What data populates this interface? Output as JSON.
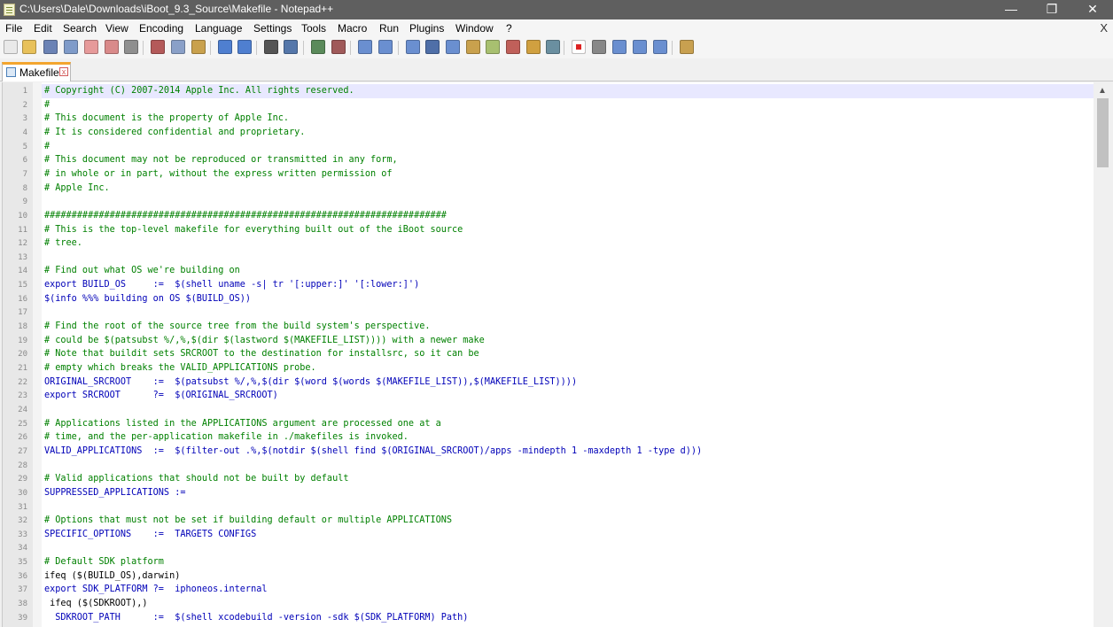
{
  "window": {
    "title": "C:\\Users\\Dale\\Downloads\\iBoot_9.3_Source\\Makefile - Notepad++",
    "minimize_glyph": "—",
    "restore_glyph": "❐",
    "close_glyph": "✕"
  },
  "menu": {
    "items": [
      "File",
      "Edit",
      "Search",
      "View",
      "Encoding",
      "Language",
      "Settings",
      "Tools",
      "Macro",
      "Run",
      "Plugins",
      "Window",
      "?"
    ],
    "close_glyph": "X"
  },
  "toolbar": {
    "icons": [
      "new-file-icon",
      "open-file-icon",
      "save-icon",
      "save-all-icon",
      "close-icon",
      "close-all-icon",
      "print-icon",
      "cut-icon",
      "copy-icon",
      "paste-icon",
      "undo-icon",
      "redo-icon",
      "find-icon",
      "replace-icon",
      "zoom-in-icon",
      "zoom-out-icon",
      "sync-vertical-icon",
      "sync-horizontal-icon",
      "word-wrap-icon",
      "show-all-characters-icon",
      "indent-guide-icon",
      "user-language-icon",
      "doc-map-icon",
      "function-list-icon",
      "folder-as-workspace-icon",
      "monitoring-icon",
      "record-macro-icon",
      "stop-recording-icon",
      "playback-macro-icon",
      "run-macro-multiple-icon",
      "save-macro-icon",
      "launch-in-browser-icon"
    ]
  },
  "tab": {
    "label": "Makefile",
    "close_glyph": "x"
  },
  "editor": {
    "lines": [
      {
        "n": "1",
        "text": "# Copyright (C) 2007-2014 Apple Inc. All rights reserved.",
        "kind": "comment"
      },
      {
        "n": "2",
        "text": "#",
        "kind": "comment"
      },
      {
        "n": "3",
        "text": "# This document is the property of Apple Inc.",
        "kind": "comment"
      },
      {
        "n": "4",
        "text": "# It is considered confidential and proprietary.",
        "kind": "comment"
      },
      {
        "n": "5",
        "text": "#",
        "kind": "comment"
      },
      {
        "n": "6",
        "text": "# This document may not be reproduced or transmitted in any form,",
        "kind": "comment"
      },
      {
        "n": "7",
        "text": "# in whole or in part, without the express written permission of",
        "kind": "comment"
      },
      {
        "n": "8",
        "text": "# Apple Inc.",
        "kind": "comment"
      },
      {
        "n": "9",
        "text": "",
        "kind": "plain"
      },
      {
        "n": "10",
        "text": "##########################################################################",
        "kind": "comment"
      },
      {
        "n": "11",
        "text": "# This is the top-level makefile for everything built out of the iBoot source",
        "kind": "comment"
      },
      {
        "n": "12",
        "text": "# tree.",
        "kind": "comment"
      },
      {
        "n": "13",
        "text": "",
        "kind": "plain"
      },
      {
        "n": "14",
        "text": "# Find out what OS we're building on",
        "kind": "comment"
      },
      {
        "n": "15",
        "text": "export BUILD_OS     :=  $(shell uname -s| tr '[:upper:]' '[:lower:]')",
        "kind": "keyword"
      },
      {
        "n": "16",
        "text": "$(info %%% building on OS $(BUILD_OS))",
        "kind": "keyword"
      },
      {
        "n": "17",
        "text": "",
        "kind": "plain"
      },
      {
        "n": "18",
        "text": "# Find the root of the source tree from the build system's perspective.",
        "kind": "comment"
      },
      {
        "n": "19",
        "text": "# could be $(patsubst %/,%,$(dir $(lastword $(MAKEFILE_LIST)))) with a newer make",
        "kind": "comment"
      },
      {
        "n": "20",
        "text": "# Note that buildit sets SRCROOT to the destination for installsrc, so it can be",
        "kind": "comment"
      },
      {
        "n": "21",
        "text": "# empty which breaks the VALID_APPLICATIONS probe.",
        "kind": "comment"
      },
      {
        "n": "22",
        "text": "ORIGINAL_SRCROOT    :=  $(patsubst %/,%,$(dir $(word $(words $(MAKEFILE_LIST)),$(MAKEFILE_LIST))))",
        "kind": "keyword"
      },
      {
        "n": "23",
        "text": "export SRCROOT      ?=  $(ORIGINAL_SRCROOT)",
        "kind": "keyword"
      },
      {
        "n": "24",
        "text": "",
        "kind": "plain"
      },
      {
        "n": "25",
        "text": "# Applications listed in the APPLICATIONS argument are processed one at a",
        "kind": "comment"
      },
      {
        "n": "26",
        "text": "# time, and the per-application makefile in ./makefiles is invoked.",
        "kind": "comment"
      },
      {
        "n": "27",
        "text": "VALID_APPLICATIONS  :=  $(filter-out .%,$(notdir $(shell find $(ORIGINAL_SRCROOT)/apps -mindepth 1 -maxdepth 1 -type d)))",
        "kind": "keyword"
      },
      {
        "n": "28",
        "text": "",
        "kind": "plain"
      },
      {
        "n": "29",
        "text": "# Valid applications that should not be built by default",
        "kind": "comment"
      },
      {
        "n": "30",
        "text": "SUPPRESSED_APPLICATIONS :=",
        "kind": "keyword"
      },
      {
        "n": "31",
        "text": "",
        "kind": "plain"
      },
      {
        "n": "32",
        "text": "# Options that must not be set if building default or multiple APPLICATIONS",
        "kind": "comment"
      },
      {
        "n": "33",
        "text": "SPECIFIC_OPTIONS    :=  TARGETS CONFIGS",
        "kind": "keyword"
      },
      {
        "n": "34",
        "text": "",
        "kind": "plain"
      },
      {
        "n": "35",
        "text": "# Default SDK platform",
        "kind": "comment"
      },
      {
        "n": "36",
        "text": "ifeq ($(BUILD_OS),darwin)",
        "kind": "plain"
      },
      {
        "n": "37",
        "text": "export SDK_PLATFORM ?=  iphoneos.internal",
        "kind": "keyword"
      },
      {
        "n": "38",
        "text": " ifeq ($(SDKROOT),)",
        "kind": "plain"
      },
      {
        "n": "39",
        "text": "  SDKROOT_PATH      :=  $(shell xcodebuild -version -sdk $(SDK_PLATFORM) Path)",
        "kind": "keyword"
      }
    ]
  },
  "scrollbar": {
    "up_glyph": "▲"
  }
}
